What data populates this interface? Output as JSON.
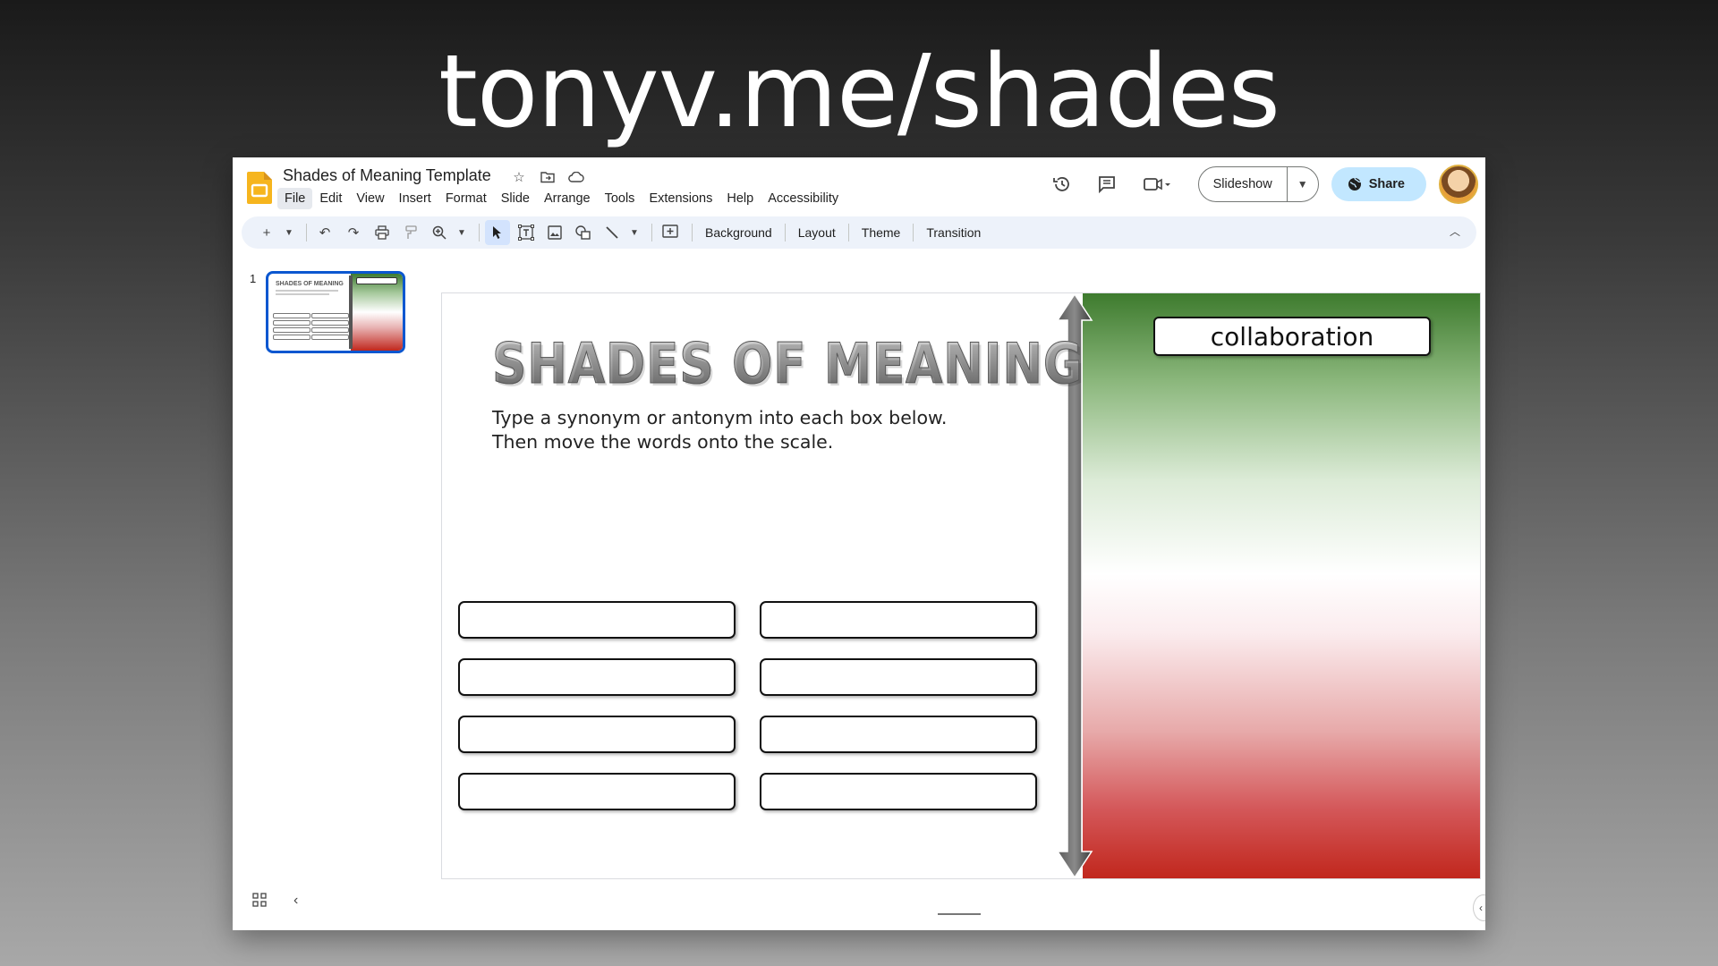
{
  "headline": "tonyv.me/shades",
  "app": {
    "document_title": "Shades of Meaning Template",
    "menu": [
      "File",
      "Edit",
      "View",
      "Insert",
      "Format",
      "Slide",
      "Arrange",
      "Tools",
      "Extensions",
      "Help",
      "Accessibility"
    ],
    "active_menu": "File",
    "slideshow_label": "Slideshow",
    "share_label": "Share",
    "accent_color": "#c2e7ff",
    "selection_color": "#0b57d0"
  },
  "toolbar": {
    "text_buttons": [
      "Background",
      "Layout",
      "Theme",
      "Transition"
    ],
    "icons": [
      "new-slide-icon",
      "undo-icon",
      "redo-icon",
      "print-icon",
      "paint-format-icon",
      "zoom-icon",
      "select-icon",
      "text-box-icon",
      "image-icon",
      "shape-icon",
      "line-icon",
      "comment-add-icon"
    ]
  },
  "filmstrip": {
    "slide_number": "1"
  },
  "slide": {
    "title": "SHADES OF MEANING",
    "instruction_line1": "Type a synonym or antonym into each box below.",
    "instruction_line2": "Then move the words onto the scale.",
    "answer_boxes": [
      "",
      "",
      "",
      "",
      "",
      "",
      "",
      ""
    ],
    "scale_word": "collaboration",
    "gradient_colors": [
      "#3e7b2e",
      "#ffffff",
      "#c1271d"
    ]
  }
}
